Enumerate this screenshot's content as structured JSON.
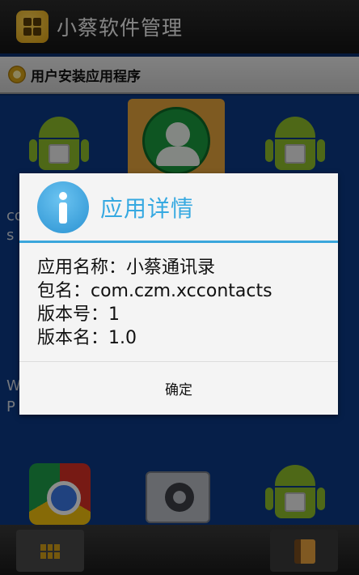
{
  "app": {
    "title": "小蔡软件管理"
  },
  "section": {
    "title": "用户安装应用程序"
  },
  "background": {
    "partial_text_1": "co",
    "partial_text_2": "s",
    "partial_text_3": "W",
    "partial_text_4": "P"
  },
  "dialog": {
    "title": "应用详情",
    "lines": [
      "应用名称：小蔡通讯录",
      "包名：com.czm.xccontacts",
      "版本号：1",
      "版本名：1.0"
    ],
    "ok_label": "确定"
  },
  "colors": {
    "accent": "#36a9e1",
    "divider": "#3aa6dc",
    "selected_tile": "#e5a53d"
  }
}
